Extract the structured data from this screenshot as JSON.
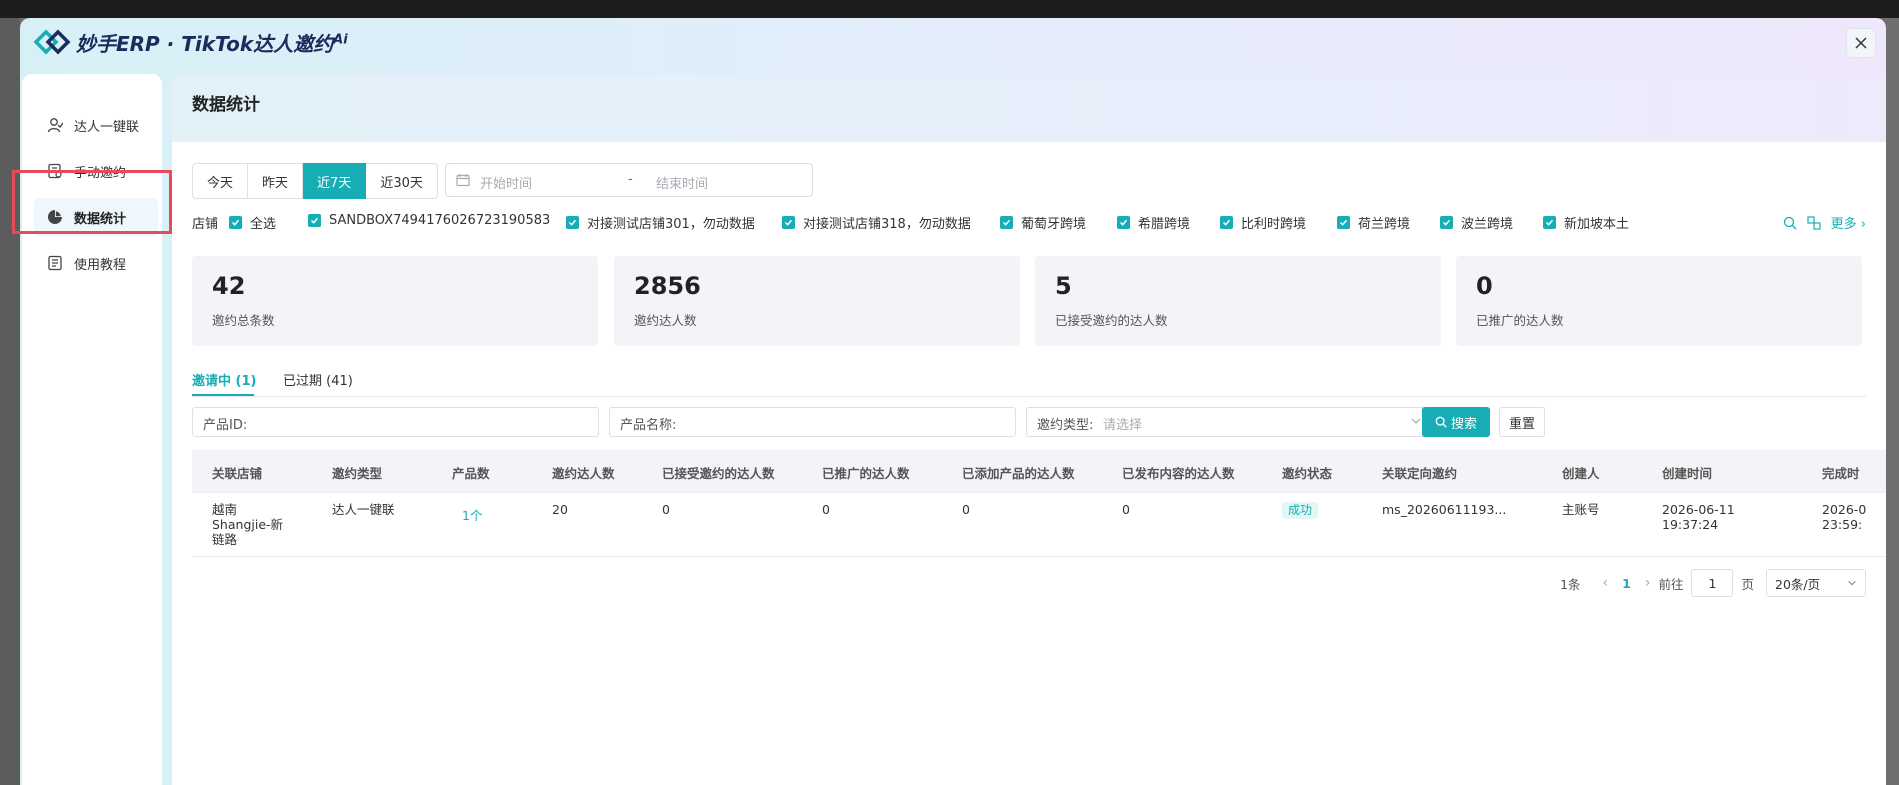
{
  "app": {
    "brand": "妙手ERP · TikTok达人邀约",
    "brand_sup": "Ai"
  },
  "sidebar": {
    "items": [
      {
        "label": "达人一键联",
        "icon": "user-icon"
      },
      {
        "label": "手动邀约",
        "icon": "invite-icon"
      },
      {
        "label": "数据统计",
        "icon": "pie-chart-icon",
        "active": true
      },
      {
        "label": "使用教程",
        "icon": "book-icon"
      }
    ]
  },
  "page": {
    "title": "数据统计"
  },
  "date_filter": {
    "options": [
      "今天",
      "昨天",
      "近7天",
      "近30天"
    ],
    "active": "近7天",
    "start_placeholder": "开始时间",
    "separator": "-",
    "end_placeholder": "结束时间"
  },
  "shops": {
    "label": "店铺",
    "items": [
      "全选",
      "SANDBOX7494176026723190583",
      "对接测试店铺301，勿动数据",
      "对接测试店铺318，勿动数据",
      "葡萄牙跨境",
      "希腊跨境",
      "比利时跨境",
      "荷兰跨境",
      "波兰跨境",
      "新加坡本土"
    ],
    "more": "更多"
  },
  "stats": [
    {
      "value": "42",
      "label": "邀约总条数"
    },
    {
      "value": "2856",
      "label": "邀约达人数"
    },
    {
      "value": "5",
      "label": "已接受邀约的达人数"
    },
    {
      "value": "0",
      "label": "已推广的达人数"
    }
  ],
  "tabs": [
    {
      "label": "邀请中 (1)",
      "active": true
    },
    {
      "label": "已过期 (41)"
    }
  ],
  "search": {
    "product_id_label": "产品ID:",
    "product_name_label": "产品名称:",
    "invite_type_label": "邀约类型:",
    "invite_type_placeholder": "请选择",
    "search_button": "搜索",
    "reset_button": "重置"
  },
  "table": {
    "columns": [
      "关联店铺",
      "邀约类型",
      "产品数",
      "邀约达人数",
      "已接受邀约的达人数",
      "已推广的达人数",
      "已添加产品的达人数",
      "已发布内容的达人数",
      "邀约状态",
      "关联定向邀约",
      "创建人",
      "创建时间",
      "完成时"
    ],
    "rows": [
      {
        "shop_line1": "越南",
        "shop_line2": "Shangjie-新",
        "shop_line3": "链路",
        "type": "达人一键联",
        "products": "1个",
        "invited": "20",
        "accepted": "0",
        "promoted": "0",
        "added": "0",
        "published": "0",
        "status": "成功",
        "targeted": "ms_20260611193...",
        "creator": "主账号",
        "created_date": "2026-06-11",
        "created_time": "19:37:24",
        "done_date": "2026-0",
        "done_time": "23:59:"
      }
    ]
  },
  "pagination": {
    "total": "1条",
    "current": "1",
    "goto_label": "前往",
    "goto_value": "1",
    "page_unit": "页",
    "page_size": "20条/页"
  },
  "colors": {
    "accent": "#16aeb4",
    "highlight": "#e54c5a"
  }
}
